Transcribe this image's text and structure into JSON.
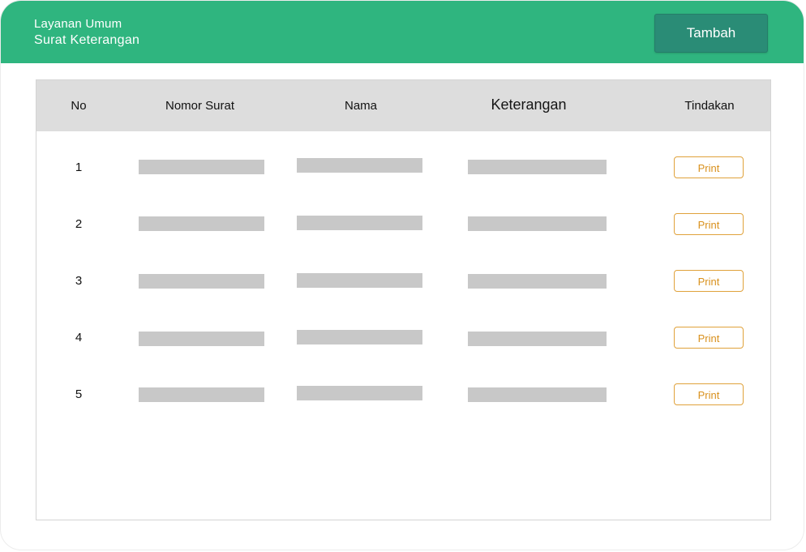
{
  "header": {
    "line1": "Layanan Umum",
    "line2": "Surat Keterangan",
    "add_button_label": "Tambah"
  },
  "table": {
    "columns": {
      "no": "No",
      "nomor_surat": "Nomor Surat",
      "nama": "Nama",
      "keterangan": "Keterangan",
      "tindakan": "Tindakan"
    },
    "rows": [
      {
        "no": "1",
        "print_label": "Print"
      },
      {
        "no": "2",
        "print_label": "Print"
      },
      {
        "no": "3",
        "print_label": "Print"
      },
      {
        "no": "4",
        "print_label": "Print"
      },
      {
        "no": "5",
        "print_label": "Print"
      }
    ]
  },
  "colors": {
    "header_bg": "#2fb57f",
    "add_button_bg": "#2a8c76",
    "print_accent": "#e0a23b",
    "table_header_bg": "#dddddd",
    "redaction": "#c8c8c8"
  }
}
